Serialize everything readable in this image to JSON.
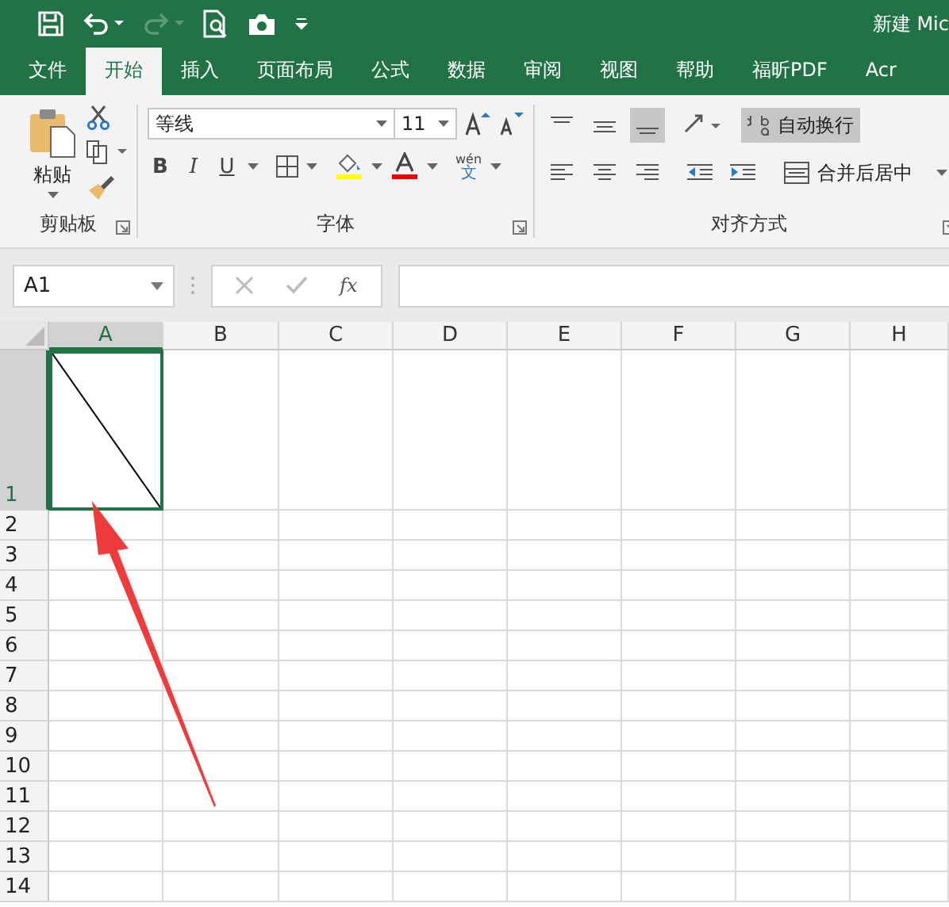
{
  "window": {
    "title": "新建 Mic"
  },
  "tabs": [
    {
      "label": "文件",
      "selected": false
    },
    {
      "label": "开始",
      "selected": true
    },
    {
      "label": "插入",
      "selected": false
    },
    {
      "label": "页面布局",
      "selected": false
    },
    {
      "label": "公式",
      "selected": false
    },
    {
      "label": "数据",
      "selected": false
    },
    {
      "label": "审阅",
      "selected": false
    },
    {
      "label": "视图",
      "selected": false
    },
    {
      "label": "帮助",
      "selected": false
    },
    {
      "label": "福昕PDF",
      "selected": false
    },
    {
      "label": "Acr",
      "selected": false
    }
  ],
  "ribbon": {
    "clipboard": {
      "paste": "粘贴",
      "label": "剪贴板"
    },
    "font": {
      "name": "等线",
      "size": "11",
      "bold": "B",
      "italic": "I",
      "underline": "U",
      "phonetic_top": "wén",
      "phonetic_bottom": "文",
      "label": "字体"
    },
    "alignment": {
      "wrap_text": "自动换行",
      "wrap_selected": true,
      "merge_center": "合并后居中",
      "bottom_align_selected": true,
      "label": "对齐方式"
    }
  },
  "formula_bar": {
    "name_box": "A1",
    "function_label": "fx"
  },
  "sheet": {
    "columns": [
      {
        "label": "A",
        "selected": true
      },
      {
        "label": "B",
        "selected": false
      },
      {
        "label": "C",
        "selected": false
      },
      {
        "label": "D",
        "selected": false
      },
      {
        "label": "E",
        "selected": false
      },
      {
        "label": "F",
        "selected": false
      },
      {
        "label": "G",
        "selected": false
      },
      {
        "label": "H",
        "selected": false
      }
    ],
    "rows": [
      {
        "label": "1",
        "selected": true
      },
      {
        "label": "2",
        "selected": false
      },
      {
        "label": "3",
        "selected": false
      },
      {
        "label": "4",
        "selected": false
      },
      {
        "label": "5",
        "selected": false
      },
      {
        "label": "6",
        "selected": false
      },
      {
        "label": "7",
        "selected": false
      },
      {
        "label": "8",
        "selected": false
      },
      {
        "label": "9",
        "selected": false
      },
      {
        "label": "10",
        "selected": false
      },
      {
        "label": "11",
        "selected": false
      },
      {
        "label": "12",
        "selected": false
      },
      {
        "label": "13",
        "selected": false
      },
      {
        "label": "14",
        "selected": false
      }
    ],
    "diagonal_cell": true,
    "annotation_arrow": true
  }
}
